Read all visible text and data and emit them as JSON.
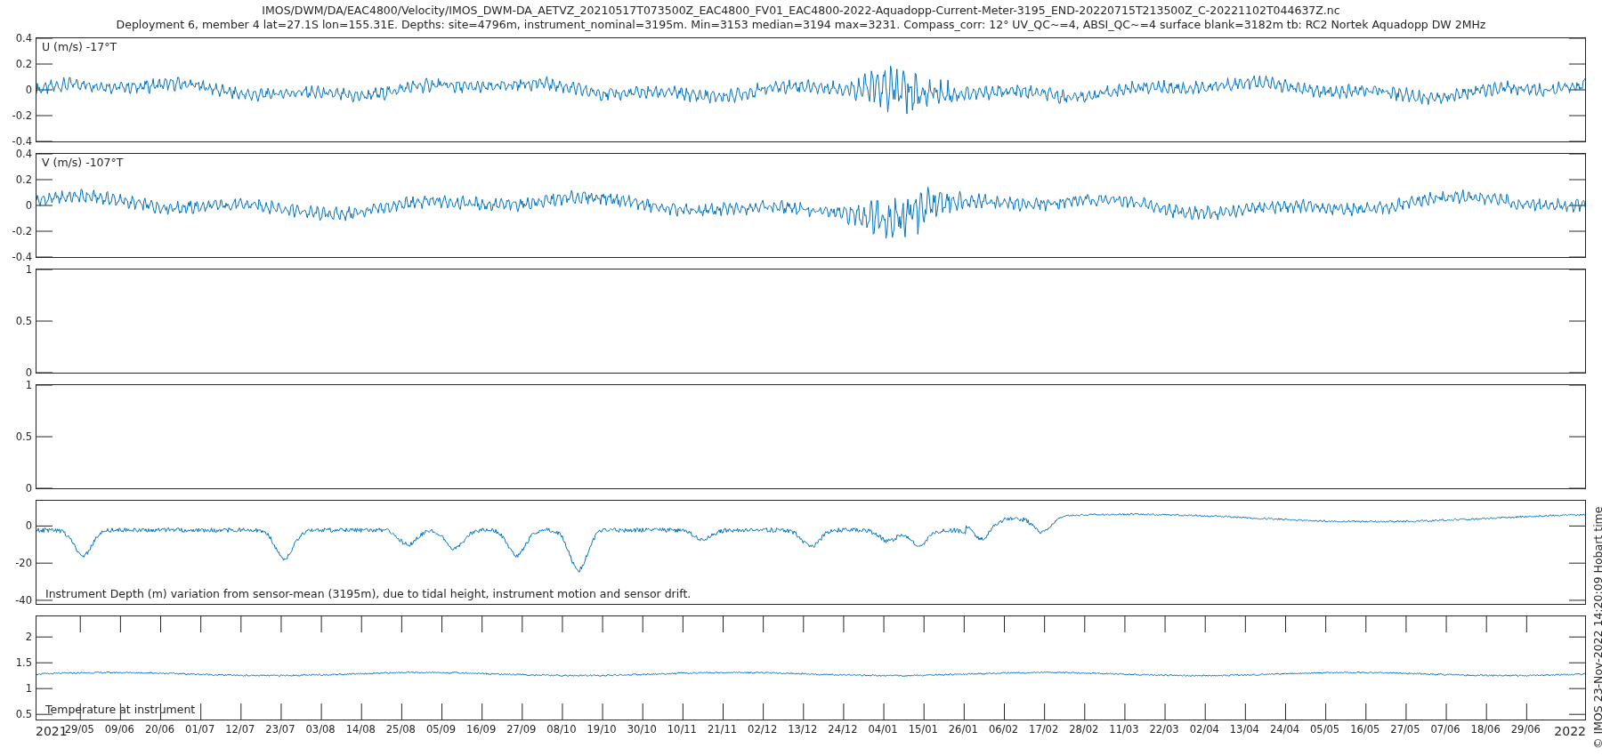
{
  "title_lines": [
    "IMOS/DWM/DA/EAC4800/Velocity/IMOS_DWM-DA_AETVZ_20210517T073500Z_EAC4800_FV01_EAC4800-2022-Aquadopp-Current-Meter-3195_END-20220715T213500Z_C-20221102T044637Z.nc",
    "Deployment 6, member 4 lat=27.1S lon=155.31E. Depths: site=4796m, instrument_nominal=3195m. Min=3153 median=3194 max=3231. Compass_corr: 12° UV_QC~=4, ABSI_QC~=4 surface blank=3182m tb: RC2 Nortek Aquadopp DW 2MHz"
  ],
  "panels": [
    {
      "kind": "velocity",
      "label": "U (m/s) -17°T",
      "y_tick_labels": [
        "0.4",
        "0.2",
        "0",
        "-0.2",
        "-0.4"
      ]
    },
    {
      "kind": "velocity",
      "label": "V (m/s) -107°T",
      "y_tick_labels": [
        "0.4",
        "0.2",
        "0",
        "-0.2",
        "-0.4"
      ]
    },
    {
      "kind": "empty",
      "y_tick_labels": [
        "1",
        "0.5",
        "0"
      ]
    },
    {
      "kind": "empty",
      "y_tick_labels": [
        "1",
        "0.5",
        "0"
      ]
    },
    {
      "kind": "depth",
      "label": "Instrument Depth (m) variation from sensor-mean (3195m), due to tidal height, instrument motion and sensor drift.",
      "y_tick_labels": [
        "0",
        "-20",
        "-40"
      ]
    },
    {
      "kind": "temperature",
      "label": "Temperature at instrument",
      "y_tick_labels": [
        "2",
        "1.5",
        "1",
        "0.5"
      ]
    }
  ],
  "x_tick_labels": [
    "29/05",
    "09/06",
    "20/06",
    "01/07",
    "12/07",
    "23/07",
    "03/08",
    "14/08",
    "25/08",
    "05/09",
    "16/09",
    "27/09",
    "08/10",
    "19/10",
    "30/10",
    "10/11",
    "21/11",
    "02/12",
    "13/12",
    "24/12",
    "04/01",
    "15/01",
    "26/01",
    "06/02",
    "17/02",
    "28/02",
    "11/03",
    "22/03",
    "02/04",
    "13/04",
    "24/04",
    "05/05",
    "16/05",
    "27/05",
    "07/06",
    "18/06",
    "29/06"
  ],
  "year_labels": [
    "2021",
    "2022"
  ],
  "stamp": "© IMOS 23-Nov-2022 14:20:09 Hobart time"
}
